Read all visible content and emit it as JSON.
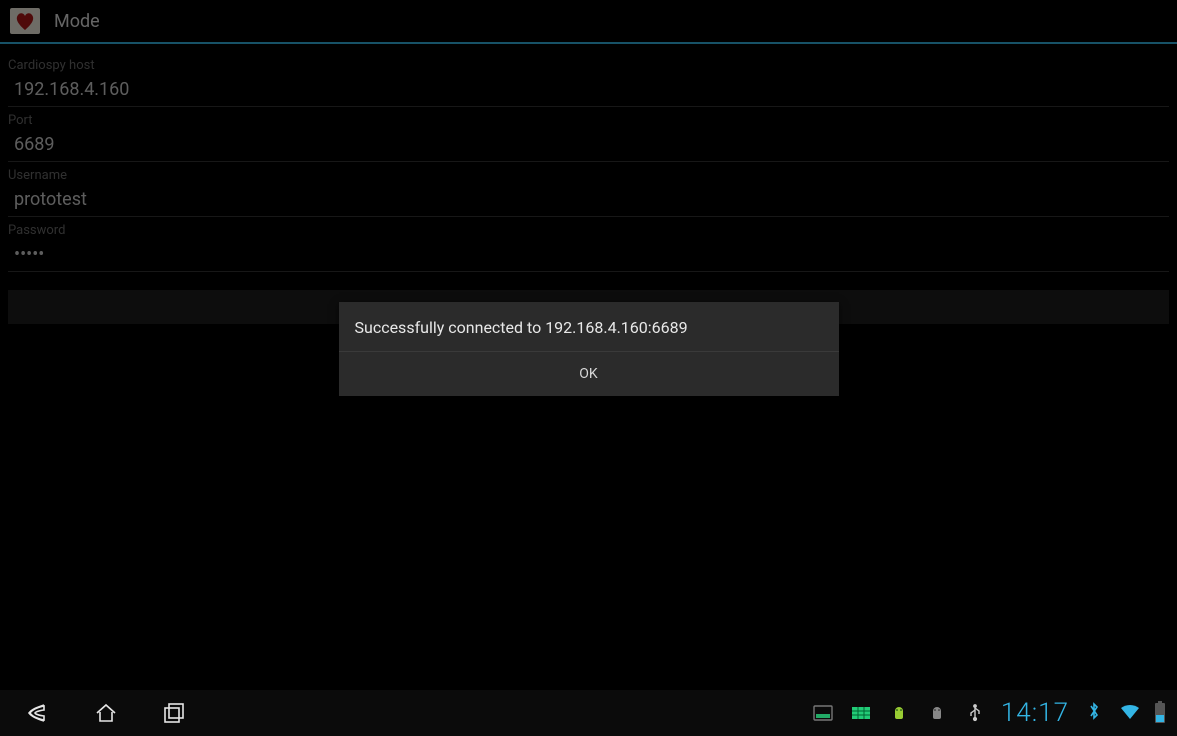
{
  "actionBar": {
    "title": "Mode"
  },
  "form": {
    "hostLabel": "Cardiospy host",
    "hostValue": "192.168.4.160",
    "portLabel": "Port",
    "portValue": "6689",
    "userLabel": "Username",
    "userValue": "prototest",
    "passLabel": "Password",
    "passValue": "•••••"
  },
  "dialog": {
    "message": "Successfully connected to 192.168.4.160:6689",
    "ok": "OK"
  },
  "status": {
    "clock": "14:17"
  }
}
